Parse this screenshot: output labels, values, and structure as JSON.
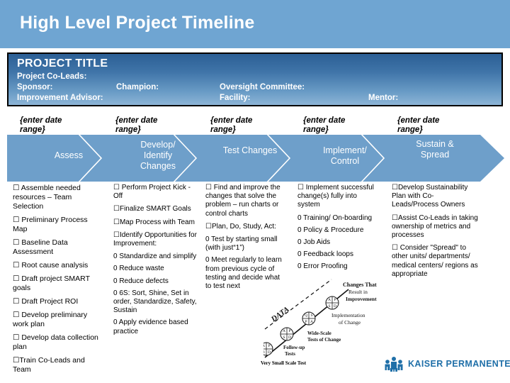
{
  "slide": {
    "title": "High Level Project Timeline"
  },
  "project_box": {
    "project_title": "PROJECT TITLE",
    "co_leads_label": "Project Co-Leads:",
    "sponsor_label": "Sponsor:",
    "champion_label": "Champion:",
    "oversight_label": "Oversight Committee:",
    "improvement_advisor_label": "Improvement Advisor:",
    "facility_label": "Facility:",
    "mentor_label": "Mentor:"
  },
  "timeline": {
    "date_placeholder": "{enter date range}",
    "band_color": "#6e9fca",
    "header_color": "#6fa5d2",
    "phases": [
      {
        "name": "Assess",
        "date_range": "{enter date range}"
      },
      {
        "name": "Develop/ Identify Changes",
        "date_range": "{enter date range}"
      },
      {
        "name": "Test Changes",
        "date_range": "{enter date range}"
      },
      {
        "name": "Implement/ Control",
        "date_range": "{enter date range}"
      },
      {
        "name": "Sustain & Spread",
        "date_range": "{enter date range}"
      }
    ]
  },
  "columns": [
    {
      "id": "assess",
      "items": [
        "☐ Assemble needed resources – Team Selection",
        "☐ Preliminary Process Map",
        "☐ Baseline Data Assessment",
        "☐ Root cause analysis",
        "☐ Draft project SMART goals",
        "☐ Draft Project ROI",
        "☐ Develop preliminary work plan",
        "☐ Develop data collection plan",
        "☐Train Co-Leads and Team"
      ]
    },
    {
      "id": "develop-identify-changes",
      "items": [
        "☐ Perform Project Kick -Off",
        "☐Finalize SMART Goals",
        "☐Map Process with Team",
        "☐Identify Opportunities for Improvement:",
        "0 Standardize and simplify",
        "0 Reduce waste",
        "0 Reduce defects",
        "0 6S: Sort, Shine, Set in order, Standardize, Safety, Sustain",
        "0 Apply evidence based practice"
      ]
    },
    {
      "id": "test-changes",
      "items": [
        "☐ Find and improve the changes that solve the problem – run charts or control charts",
        "☐Plan, Do, Study, Act:",
        "0 Test by starting small (with just“1”)",
        "0 Meet regularly to learn from previous cycle of testing and decide what to test next"
      ]
    },
    {
      "id": "implement-control",
      "items": [
        "☐ Implement successful change(s) fully into system",
        "0 Training/ On-boarding",
        "0 Policy & Procedure",
        "0 Job Aids",
        "0 Feedback loops",
        "0 Error Proofing"
      ]
    },
    {
      "id": "sustain-spread",
      "items": [
        "☐Develop Sustainability Plan with Co-Leads/Process Owners",
        "☐Assist Co-Leads in taking ownership of metrics and processes",
        "☐ Consider \"Spread\" to other units/ departments/ medical centers/ regions as appropriate"
      ]
    }
  ],
  "pdsa_ramp": {
    "data_label": "DATA",
    "annotations": [
      "Changes That Result in Improvement",
      "Implementation of Change",
      "Wide-Scale Tests of Change",
      "Follow-up Tests",
      "Very Small Scale Test"
    ],
    "cycle_letters": [
      "A",
      "P",
      "S",
      "D"
    ]
  },
  "logo": {
    "brand": "KAISER PERMANENTE",
    "registered_mark": "®",
    "color": "#1f6fa8"
  }
}
